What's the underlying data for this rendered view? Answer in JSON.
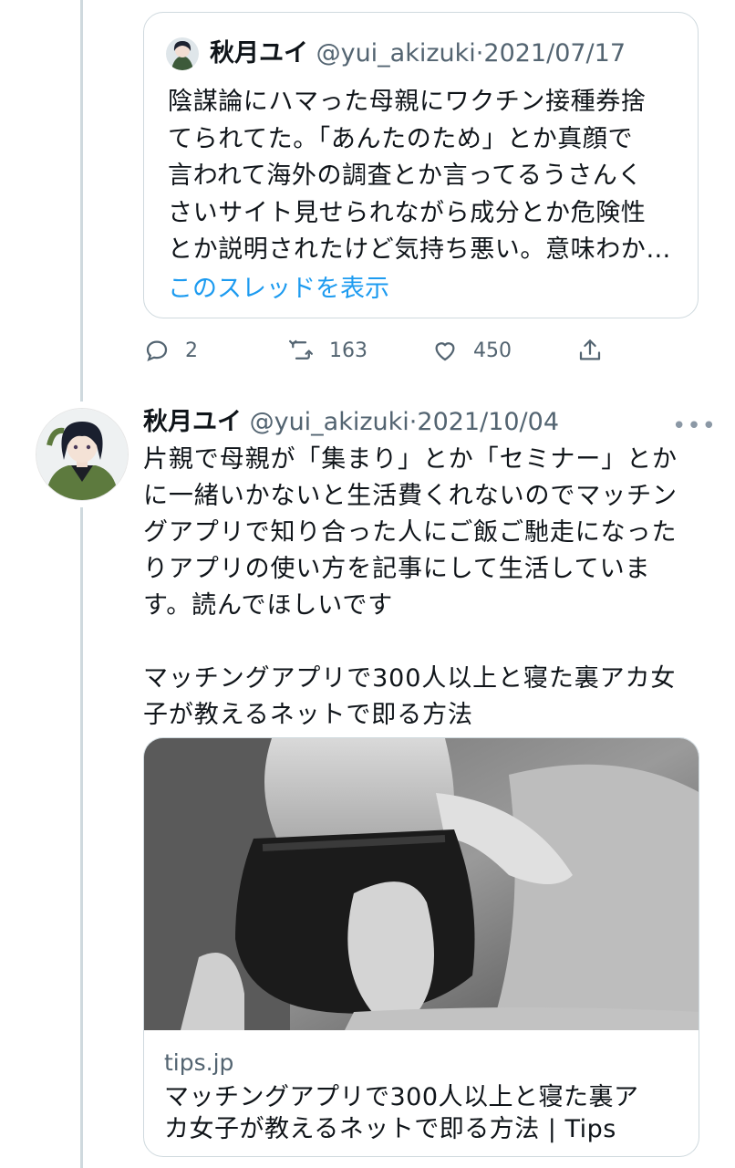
{
  "quoted_tweet": {
    "author_name": "秋月ユイ",
    "handle": "@yui_akizuki",
    "date": "2021/07/17",
    "text_lines": [
      "陰謀論にハマった母親にワクチン接種券捨",
      "てられてた。「あんたのため」とか真顔で",
      "言われて海外の調査とか言ってるうさんく",
      "さいサイト見せられながら成分とか危険性",
      "とか説明されたけど気持ち悪い。意味わか…"
    ],
    "show_thread_label": "このスレッドを表示"
  },
  "actions": {
    "reply_count": "2",
    "retweet_count": "163",
    "like_count": "450"
  },
  "tweet": {
    "author_name": "秋月ユイ",
    "handle": "@yui_akizuki",
    "date": "2021/10/04",
    "more_label": "•••",
    "lines": [
      "片親で母親が「集まり」とか「セミナー」とか",
      "に一緒いかないと生活費くれないのでマッチン",
      "グアプリで知り合った人にご飯ご馳走になった",
      "りアプリの使い方を記事にして生活していま",
      "す。読んでほしいです"
    ],
    "lines2": [
      "マッチングアプリで300人以上と寝た裏アカ女",
      "子が教えるネットで即る方法"
    ]
  },
  "link_card": {
    "domain": "tips.jp",
    "title_lines": [
      "マッチングアプリで300人以上と寝た裏ア",
      "カ女子が教えるネットで即る方法 | Tips"
    ]
  },
  "colors": {
    "link_blue": "#1d9bf0",
    "secondary_text": "#536471",
    "border": "#cfd9de"
  }
}
